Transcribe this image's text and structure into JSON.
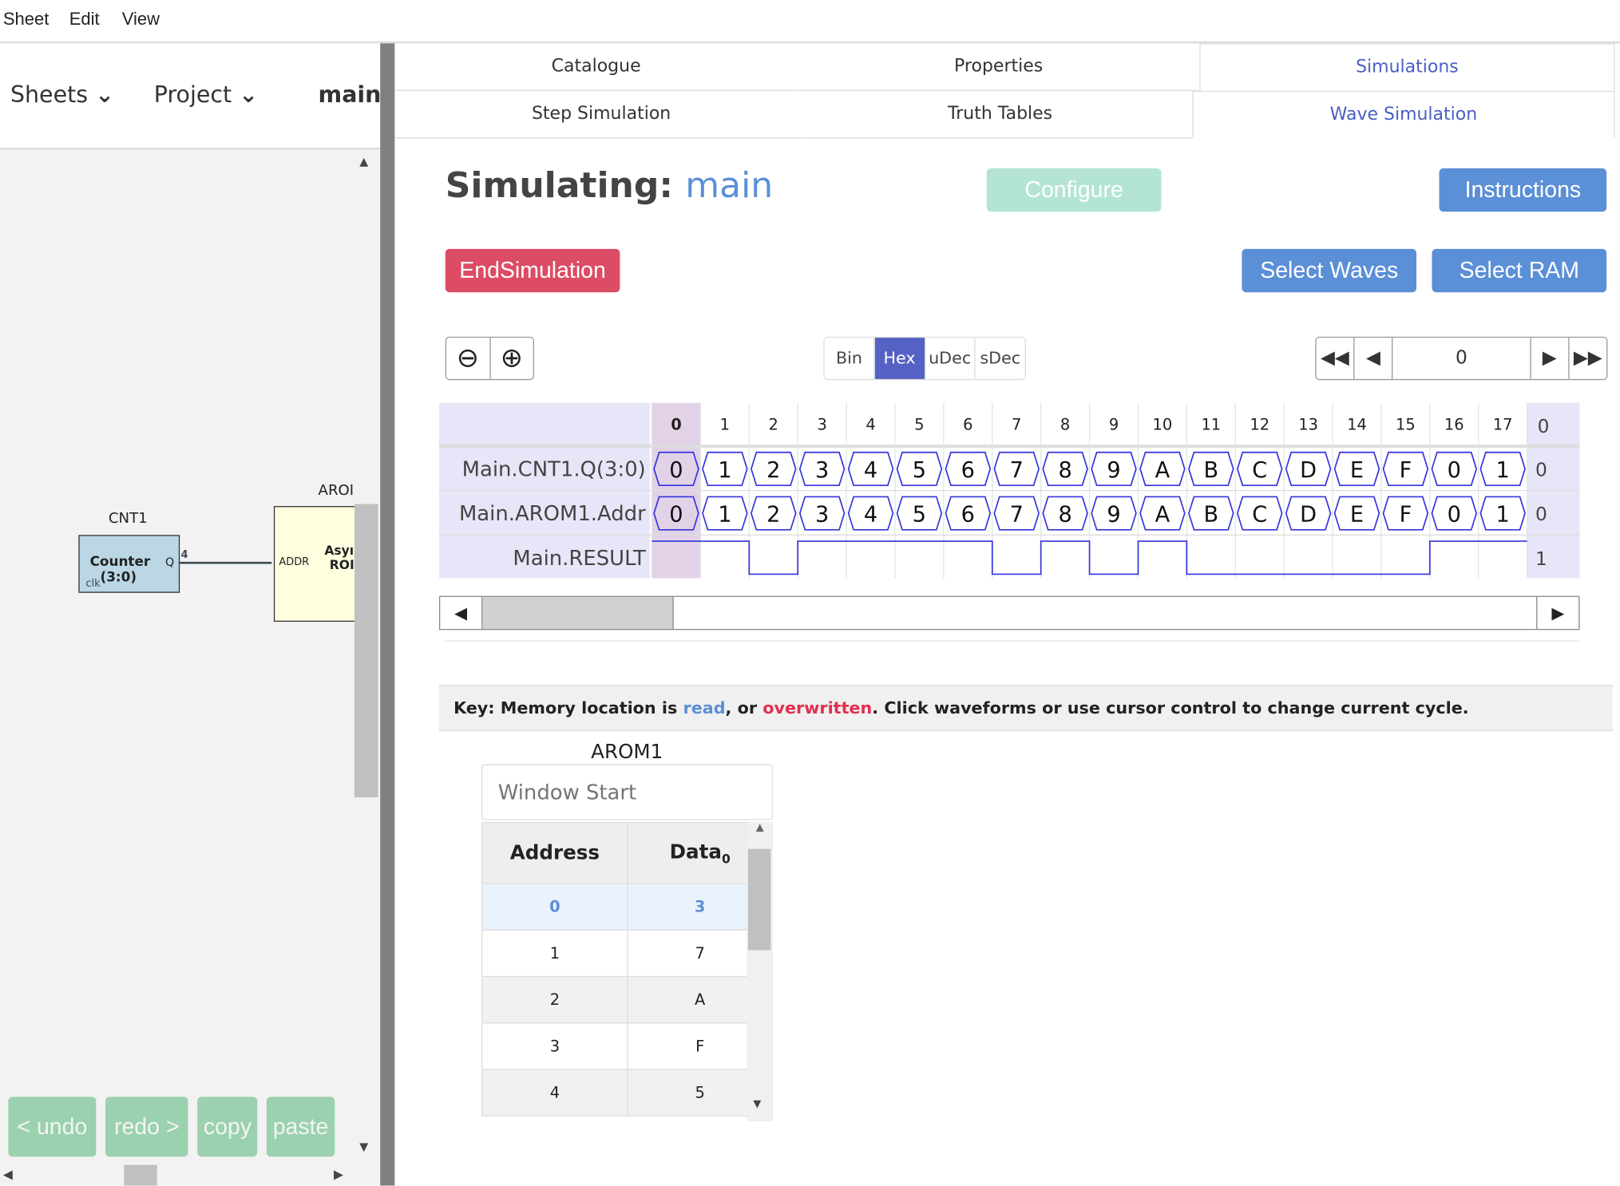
{
  "menu": [
    "Sheet",
    "Edit",
    "View"
  ],
  "left": {
    "sheets": "Sheets",
    "project": "Project",
    "sheet_name": "main",
    "cnt1": {
      "name": "CNT1",
      "title1": "Counter",
      "title2": "(3:0)",
      "q": "Q",
      "clk": "clk",
      "width": "4"
    },
    "arom1": {
      "name": "AROI",
      "addr": "ADDR",
      "title1": "Asyı",
      "title2": "ROI"
    },
    "buttons": [
      "< undo",
      "redo >",
      "copy",
      "paste"
    ]
  },
  "tabs_top": [
    "Catalogue",
    "Properties",
    "Simulations"
  ],
  "tabs_sub": [
    "Step Simulation",
    "Truth Tables",
    "Wave Simulation"
  ],
  "sim": {
    "title": "Simulating:",
    "sheet": "main",
    "configure": "Configure",
    "instructions": "Instructions",
    "end": "EndSimulation",
    "select_waves": "Select Waves",
    "select_ram": "Select RAM",
    "radix": [
      "Bin",
      "Hex",
      "uDec",
      "sDec"
    ],
    "radix_selected": "Hex",
    "cycle": "0",
    "colors": {
      "accent": "#4a5fc1",
      "blue_btn": "#5b8fd6",
      "red_btn": "#dc4c64",
      "wave": "#3333dd"
    }
  },
  "wave": {
    "cycles": [
      "0",
      "1",
      "2",
      "3",
      "4",
      "5",
      "6",
      "7",
      "8",
      "9",
      "10",
      "11",
      "12",
      "13",
      "14",
      "15",
      "16",
      "17"
    ],
    "current": 0,
    "signals": [
      {
        "name": "Main.CNT1.Q(3:0)",
        "type": "bus",
        "values": [
          "0",
          "1",
          "2",
          "3",
          "4",
          "5",
          "6",
          "7",
          "8",
          "9",
          "A",
          "B",
          "C",
          "D",
          "E",
          "F",
          "0",
          "1"
        ],
        "current": "0"
      },
      {
        "name": "Main.AROM1.Addr",
        "type": "bus",
        "values": [
          "0",
          "1",
          "2",
          "3",
          "4",
          "5",
          "6",
          "7",
          "8",
          "9",
          "A",
          "B",
          "C",
          "D",
          "E",
          "F",
          "0",
          "1"
        ],
        "current": "0"
      },
      {
        "name": "Main.RESULT",
        "type": "bit",
        "values": [
          1,
          1,
          0,
          1,
          1,
          1,
          1,
          0,
          1,
          0,
          1,
          0,
          0,
          0,
          0,
          0,
          1,
          1
        ],
        "current": "1"
      }
    ],
    "header_current": "0"
  },
  "key": {
    "pre": "Key: Memory location is ",
    "read": "read",
    "mid": ", or ",
    "overwritten": "overwritten",
    "post": ". Click waveforms or use cursor control to change current cycle."
  },
  "ram": {
    "title": "AROM1",
    "placeholder": "Window Start",
    "headers": [
      "Address",
      "Data"
    ],
    "data_sub": "0",
    "rows": [
      [
        "0",
        "3"
      ],
      [
        "1",
        "7"
      ],
      [
        "2",
        "A"
      ],
      [
        "3",
        "F"
      ],
      [
        "4",
        "5"
      ]
    ]
  }
}
